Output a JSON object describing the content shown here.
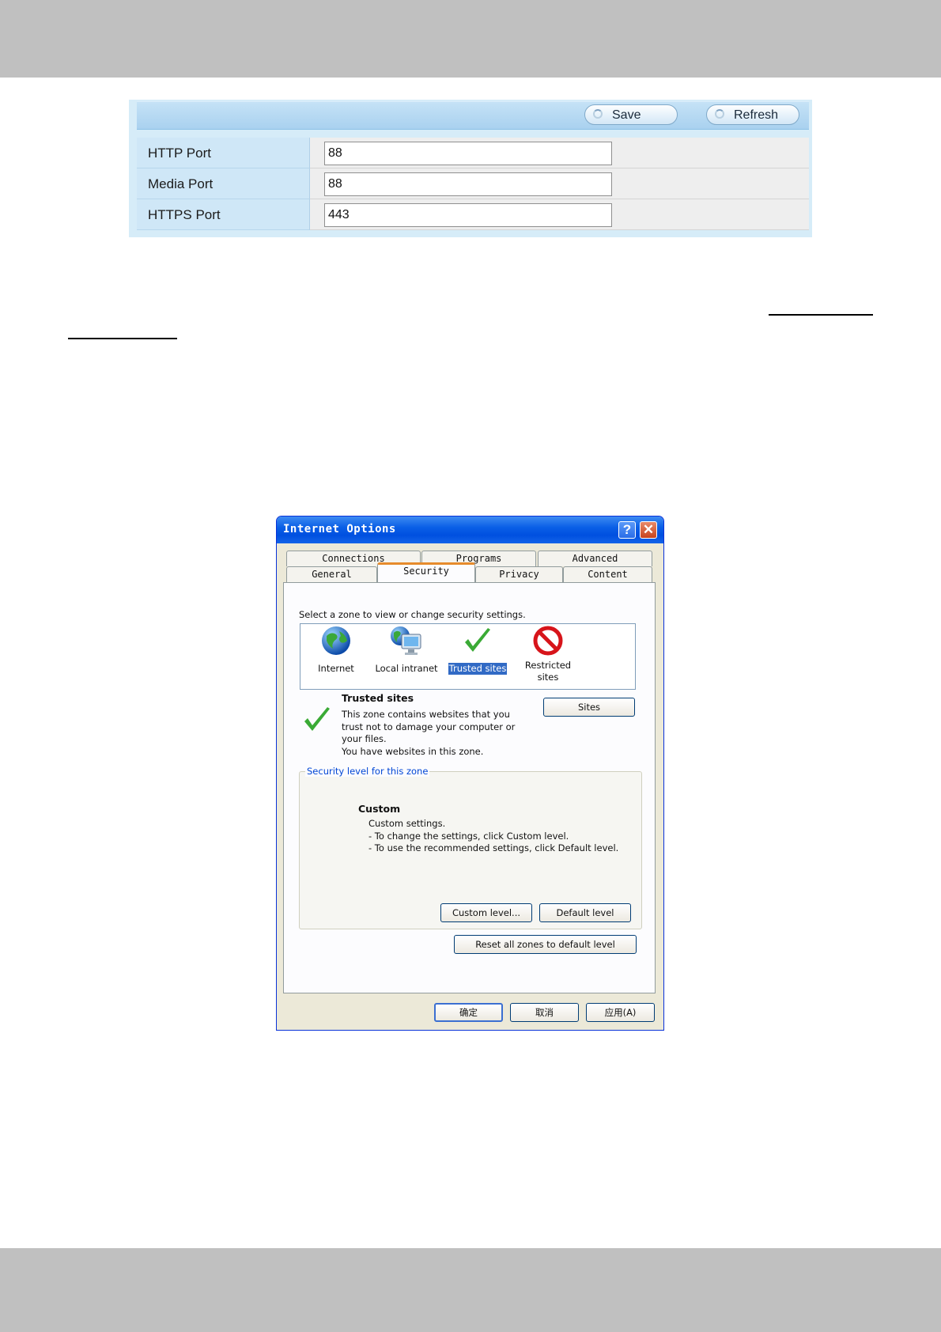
{
  "port_panel": {
    "save_label": "Save",
    "refresh_label": "Refresh",
    "rows": [
      {
        "label": "HTTP Port",
        "value": "88"
      },
      {
        "label": "Media Port",
        "value": "88"
      },
      {
        "label": "HTTPS Port",
        "value": "443"
      }
    ]
  },
  "dialog": {
    "title": "Internet Options",
    "help_glyph": "?",
    "close_glyph": "✕",
    "tabs_back": [
      "Connections",
      "Programs",
      "Advanced"
    ],
    "tabs_front": [
      "General",
      "Security",
      "Privacy",
      "Content"
    ],
    "active_tab": "Security",
    "zone_prompt": "Select a zone to view or change security settings.",
    "zones": [
      {
        "label": "Internet",
        "icon": "globe-icon"
      },
      {
        "label": "Local intranet",
        "icon": "intranet-icon"
      },
      {
        "label": "Trusted sites",
        "icon": "checkmark-icon"
      },
      {
        "label": "Restricted sites",
        "icon": "restricted-icon"
      }
    ],
    "selected_zone": "Trusted sites",
    "zone_heading": "Trusted sites",
    "zone_description": [
      "This zone contains websites that you",
      "trust not to damage your computer or",
      "your files.",
      "You have websites in this zone."
    ],
    "sites_button": "Sites",
    "group_title": "Security level for this zone",
    "level_name": "Custom",
    "level_description": [
      "Custom settings.",
      "- To change the settings, click Custom level.",
      "- To use the recommended settings, click Default level."
    ],
    "custom_level_button": "Custom level...",
    "default_level_button": "Default level",
    "reset_button": "Reset all zones to default level",
    "ok_button": "确定",
    "cancel_button": "取消",
    "apply_button": "应用(A)"
  },
  "colors": {
    "header_bar": "#c0c0c0",
    "panel_blue": "#cfe7f7",
    "title_blue": "#0050e0",
    "selection_blue": "#316ac5",
    "check_green": "#3aaa35",
    "restricted_red": "#d7141a"
  }
}
